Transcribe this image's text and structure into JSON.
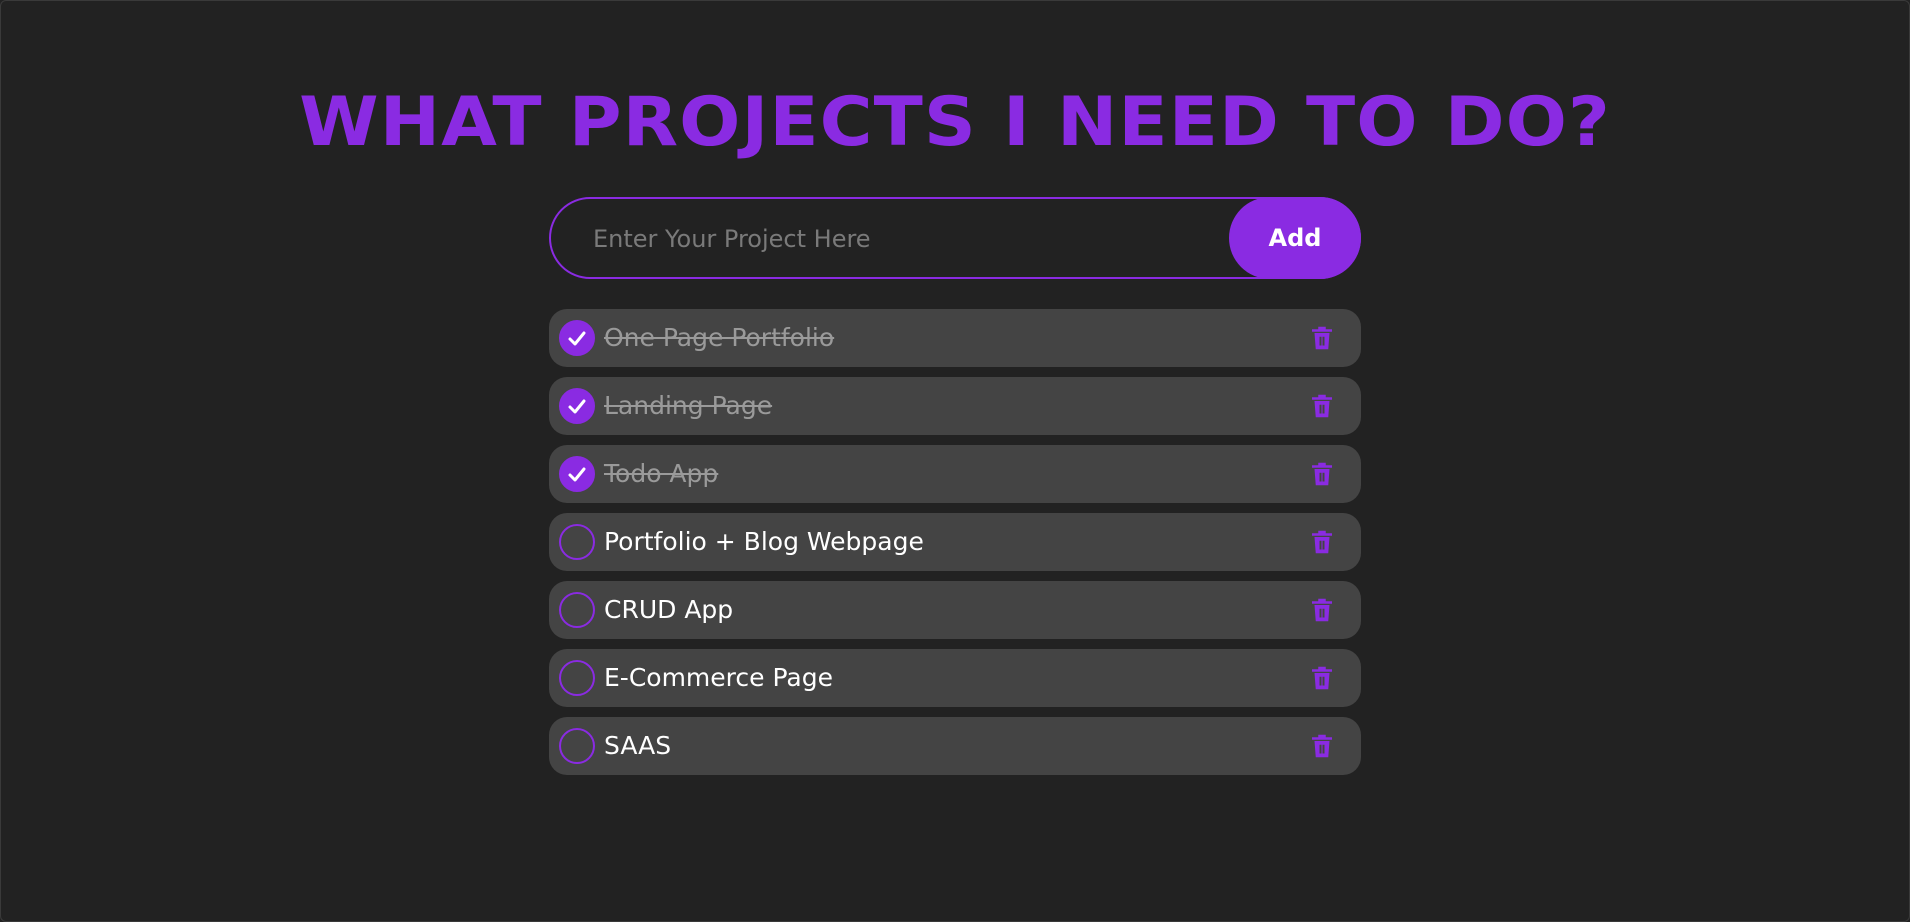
{
  "header": {
    "title": "WHAT PROJECTS I NEED TO DO?"
  },
  "form": {
    "placeholder": "Enter Your Project Here",
    "value": "",
    "add_label": "Add"
  },
  "todos": [
    {
      "text": "One Page Portfolio",
      "done": true
    },
    {
      "text": "Landing Page",
      "done": true
    },
    {
      "text": "Todo App",
      "done": true
    },
    {
      "text": "Portfolio + Blog Webpage",
      "done": false
    },
    {
      "text": "CRUD App",
      "done": false
    },
    {
      "text": "E-Commerce Page",
      "done": false
    },
    {
      "text": "SAAS",
      "done": false
    }
  ],
  "icons": {
    "check": "check-icon",
    "delete": "trash-icon"
  },
  "colors": {
    "accent": "#8a2be2",
    "background": "#222222",
    "item_bg": "#444444"
  }
}
